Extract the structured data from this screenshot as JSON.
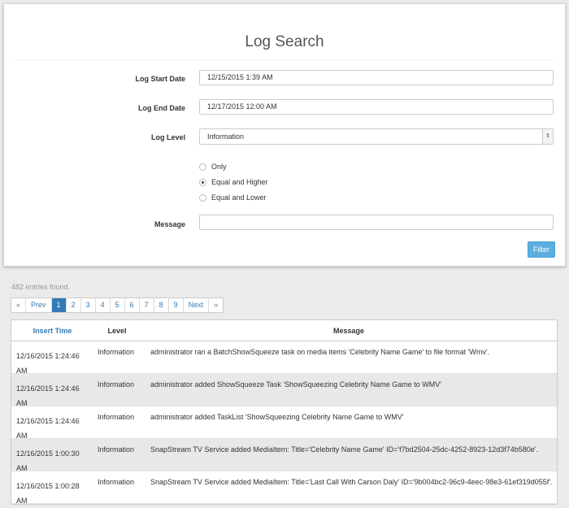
{
  "form": {
    "title": "Log Search",
    "start_label": "Log Start Date",
    "start_value": "12/15/2015 1:39 AM",
    "end_label": "Log End Date",
    "end_value": "12/17/2015 12:00 AM",
    "level_label": "Log Level",
    "level_value": "Information",
    "radio_options": [
      {
        "label": "Only",
        "checked": false
      },
      {
        "label": "Equal and Higher",
        "checked": true
      },
      {
        "label": "Equal and Lower",
        "checked": false
      }
    ],
    "message_label": "Message",
    "message_value": "",
    "filter_label": "Filter"
  },
  "results": {
    "count_text": "482 entries found."
  },
  "pagination": {
    "first": "«",
    "prev": "Prev",
    "pages": [
      "1",
      "2",
      "3",
      "4",
      "5",
      "6",
      "7",
      "8",
      "9"
    ],
    "active": "1",
    "next": "Next",
    "last": "»"
  },
  "table": {
    "headers": {
      "time": "Insert Time",
      "level": "Level",
      "message": "Message"
    },
    "rows": [
      {
        "time_line1": "12/16/2015 1:24:46",
        "time_line2": "AM",
        "level": "Information",
        "message": "administrator ran a BatchShowSqueeze task on media items 'Celebrity Name Game' to file format 'Wmv'."
      },
      {
        "time_line1": "12/16/2015 1:24:46",
        "time_line2": "AM",
        "level": "Information",
        "message": "administrator added ShowSqueeze Task 'ShowSqueezing Celebrity Name Game to WMV'"
      },
      {
        "time_line1": "12/16/2015 1:24:46",
        "time_line2": "AM",
        "level": "Information",
        "message": "administrator added TaskList 'ShowSqueezing Celebrity Name Game to WMV'"
      },
      {
        "time_line1": "12/16/2015 1:00:30",
        "time_line2": "AM",
        "level": "Information",
        "message": "SnapStream TV Service added MediaItem: Title='Celebrity Name Game' ID='f7bd2504-25dc-4252-8923-12d3f74b580e'."
      },
      {
        "time_line1": "12/16/2015 1:00:28",
        "time_line2": "AM",
        "level": "Information",
        "message": "SnapStream TV Service added MediaItem: Title='Last Call With Carson Daly' ID='9b004bc2-96c9-4eec-98e3-61ef319d055f'."
      }
    ]
  }
}
